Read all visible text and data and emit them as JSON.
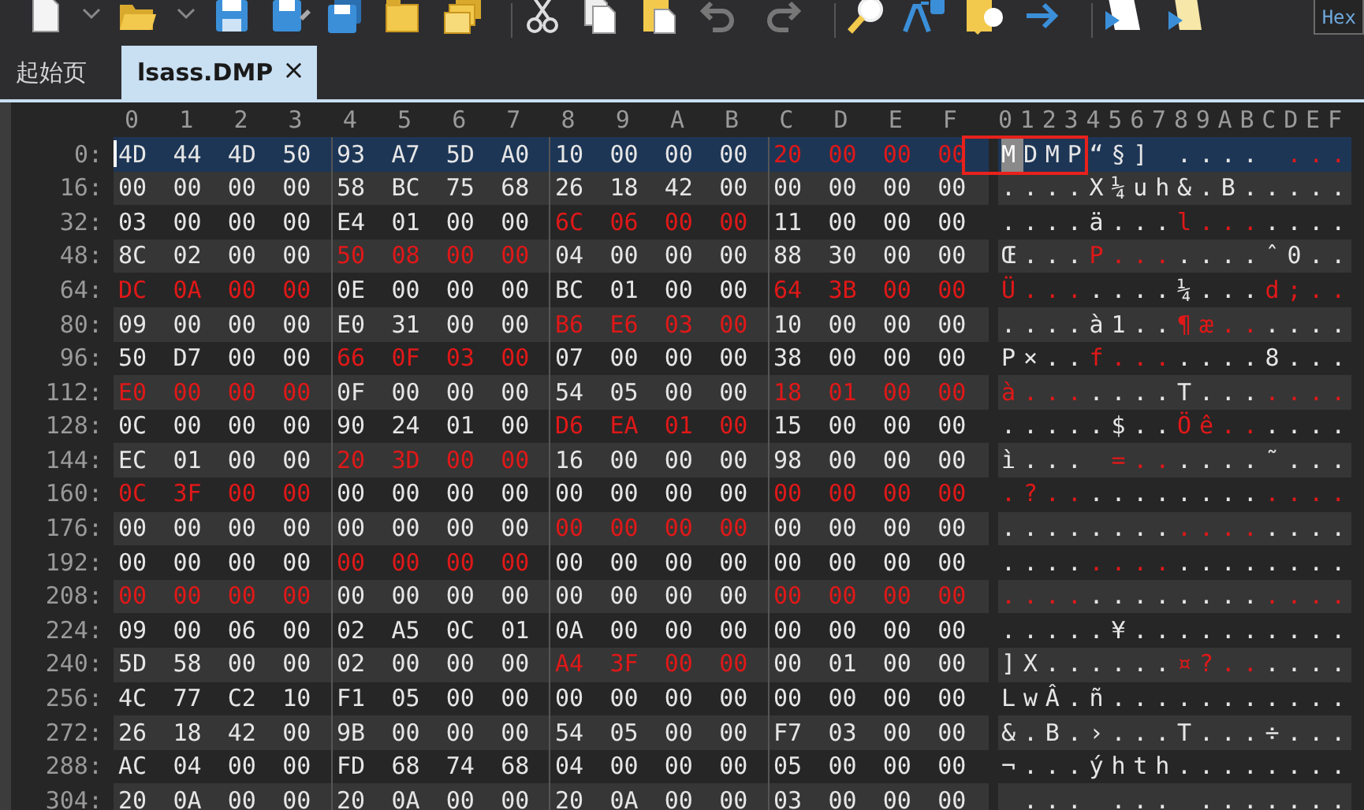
{
  "toolbar": {
    "undo_enabled": false,
    "redo_enabled": false,
    "mode_button": "Hex"
  },
  "tabs": [
    {
      "label": "起始页",
      "selected": false,
      "closable": false
    },
    {
      "label": "lsass.DMP",
      "selected": true,
      "closable": true,
      "close_glyph": "×"
    }
  ],
  "columns": [
    "0",
    "1",
    "2",
    "3",
    "4",
    "5",
    "6",
    "7",
    "8",
    "9",
    "A",
    "B",
    "C",
    "D",
    "E",
    "F"
  ],
  "ascii_header": "0123456789ABCDEF",
  "rows": [
    {
      "offset": "0:",
      "selected": true,
      "groups": [
        {
          "hex": "4D 44 4D 50",
          "marked": false
        },
        {
          "hex": "93 A7 5D A0",
          "marked": false
        },
        {
          "hex": "10 00 00 00",
          "marked": false
        },
        {
          "hex": "20 00 00 00",
          "marked": true
        }
      ],
      "ascii": "MDMP“§] .... ..."
    },
    {
      "offset": "16:",
      "selected": false,
      "groups": [
        {
          "hex": "00 00 00 00",
          "marked": false
        },
        {
          "hex": "58 BC 75 68",
          "marked": false
        },
        {
          "hex": "26 18 42 00",
          "marked": false
        },
        {
          "hex": "00 00 00 00",
          "marked": false
        }
      ],
      "ascii": "....X¼uh&.B....."
    },
    {
      "offset": "32:",
      "selected": false,
      "groups": [
        {
          "hex": "03 00 00 00",
          "marked": false
        },
        {
          "hex": "E4 01 00 00",
          "marked": false
        },
        {
          "hex": "6C 06 00 00",
          "marked": true
        },
        {
          "hex": "11 00 00 00",
          "marked": false
        }
      ],
      "ascii": "....ä...l......."
    },
    {
      "offset": "48:",
      "selected": false,
      "groups": [
        {
          "hex": "8C 02 00 00",
          "marked": false
        },
        {
          "hex": "50 08 00 00",
          "marked": true
        },
        {
          "hex": "04 00 00 00",
          "marked": false
        },
        {
          "hex": "88 30 00 00",
          "marked": false
        }
      ],
      "ascii": "Œ...P.......ˆ0.."
    },
    {
      "offset": "64:",
      "selected": false,
      "groups": [
        {
          "hex": "DC 0A 00 00",
          "marked": true
        },
        {
          "hex": "0E 00 00 00",
          "marked": false
        },
        {
          "hex": "BC 01 00 00",
          "marked": false
        },
        {
          "hex": "64 3B 00 00",
          "marked": true
        }
      ],
      "ascii": "Ü.......¼...d;.."
    },
    {
      "offset": "80:",
      "selected": false,
      "groups": [
        {
          "hex": "09 00 00 00",
          "marked": false
        },
        {
          "hex": "E0 31 00 00",
          "marked": false
        },
        {
          "hex": "B6 E6 03 00",
          "marked": true
        },
        {
          "hex": "10 00 00 00",
          "marked": false
        }
      ],
      "ascii": "....à1..¶æ......"
    },
    {
      "offset": "96:",
      "selected": false,
      "groups": [
        {
          "hex": "50 D7 00 00",
          "marked": false
        },
        {
          "hex": "66 0F 03 00",
          "marked": true
        },
        {
          "hex": "07 00 00 00",
          "marked": false
        },
        {
          "hex": "38 00 00 00",
          "marked": false
        }
      ],
      "ascii": "P×..f.......8..."
    },
    {
      "offset": "112:",
      "selected": false,
      "groups": [
        {
          "hex": "E0 00 00 00",
          "marked": true
        },
        {
          "hex": "0F 00 00 00",
          "marked": false
        },
        {
          "hex": "54 05 00 00",
          "marked": false
        },
        {
          "hex": "18 01 00 00",
          "marked": true
        }
      ],
      "ascii": "à.......T......."
    },
    {
      "offset": "128:",
      "selected": false,
      "groups": [
        {
          "hex": "0C 00 00 00",
          "marked": false
        },
        {
          "hex": "90 24 01 00",
          "marked": false
        },
        {
          "hex": "D6 EA 01 00",
          "marked": true
        },
        {
          "hex": "15 00 00 00",
          "marked": false
        }
      ],
      "ascii": ".....$..Öê......"
    },
    {
      "offset": "144:",
      "selected": false,
      "groups": [
        {
          "hex": "EC 01 00 00",
          "marked": false
        },
        {
          "hex": "20 3D 00 00",
          "marked": true
        },
        {
          "hex": "16 00 00 00",
          "marked": false
        },
        {
          "hex": "98 00 00 00",
          "marked": false
        }
      ],
      "ascii": "ì... =......˜..."
    },
    {
      "offset": "160:",
      "selected": false,
      "groups": [
        {
          "hex": "0C 3F 00 00",
          "marked": true
        },
        {
          "hex": "00 00 00 00",
          "marked": false
        },
        {
          "hex": "00 00 00 00",
          "marked": false
        },
        {
          "hex": "00 00 00 00",
          "marked": true
        }
      ],
      "ascii": ".?.............."
    },
    {
      "offset": "176:",
      "selected": false,
      "groups": [
        {
          "hex": "00 00 00 00",
          "marked": false
        },
        {
          "hex": "00 00 00 00",
          "marked": false
        },
        {
          "hex": "00 00 00 00",
          "marked": true
        },
        {
          "hex": "00 00 00 00",
          "marked": false
        }
      ],
      "ascii": "................"
    },
    {
      "offset": "192:",
      "selected": false,
      "groups": [
        {
          "hex": "00 00 00 00",
          "marked": false
        },
        {
          "hex": "00 00 00 00",
          "marked": true
        },
        {
          "hex": "00 00 00 00",
          "marked": false
        },
        {
          "hex": "00 00 00 00",
          "marked": false
        }
      ],
      "ascii": "................"
    },
    {
      "offset": "208:",
      "selected": false,
      "groups": [
        {
          "hex": "00 00 00 00",
          "marked": true
        },
        {
          "hex": "00 00 00 00",
          "marked": false
        },
        {
          "hex": "00 00 00 00",
          "marked": false
        },
        {
          "hex": "00 00 00 00",
          "marked": true
        }
      ],
      "ascii": "................"
    },
    {
      "offset": "224:",
      "selected": false,
      "groups": [
        {
          "hex": "09 00 06 00",
          "marked": false
        },
        {
          "hex": "02 A5 0C 01",
          "marked": false
        },
        {
          "hex": "0A 00 00 00",
          "marked": false
        },
        {
          "hex": "00 00 00 00",
          "marked": false
        }
      ],
      "ascii": ".....¥.........."
    },
    {
      "offset": "240:",
      "selected": false,
      "groups": [
        {
          "hex": "5D 58 00 00",
          "marked": false
        },
        {
          "hex": "02 00 00 00",
          "marked": false
        },
        {
          "hex": "A4 3F 00 00",
          "marked": true
        },
        {
          "hex": "00 01 00 00",
          "marked": false
        }
      ],
      "ascii": "]X......¤?......"
    },
    {
      "offset": "256:",
      "selected": false,
      "groups": [
        {
          "hex": "4C 77 C2 10",
          "marked": false
        },
        {
          "hex": "F1 05 00 00",
          "marked": false
        },
        {
          "hex": "00 00 00 00",
          "marked": false
        },
        {
          "hex": "00 00 00 00",
          "marked": false
        }
      ],
      "ascii": "LwÂ.ñ..........."
    },
    {
      "offset": "272:",
      "selected": false,
      "groups": [
        {
          "hex": "26 18 42 00",
          "marked": false
        },
        {
          "hex": "9B 00 00 00",
          "marked": false
        },
        {
          "hex": "54 05 00 00",
          "marked": false
        },
        {
          "hex": "F7 03 00 00",
          "marked": false
        }
      ],
      "ascii": "&.B.›...T...÷..."
    },
    {
      "offset": "288:",
      "selected": false,
      "groups": [
        {
          "hex": "AC 04 00 00",
          "marked": false
        },
        {
          "hex": "FD 68 74 68",
          "marked": false
        },
        {
          "hex": "04 00 00 00",
          "marked": false
        },
        {
          "hex": "05 00 00 00",
          "marked": false
        }
      ],
      "ascii": "¬...ýhth........"
    },
    {
      "offset": "304:",
      "selected": false,
      "groups": [
        {
          "hex": "20 0A 00 00",
          "marked": false
        },
        {
          "hex": "20 0A 00 00",
          "marked": false
        },
        {
          "hex": "20 0A 00 00",
          "marked": false
        },
        {
          "hex": "03 00 00 00",
          "marked": false
        }
      ],
      "ascii": " ... ... ......."
    }
  ],
  "callout": {
    "shown": true
  }
}
